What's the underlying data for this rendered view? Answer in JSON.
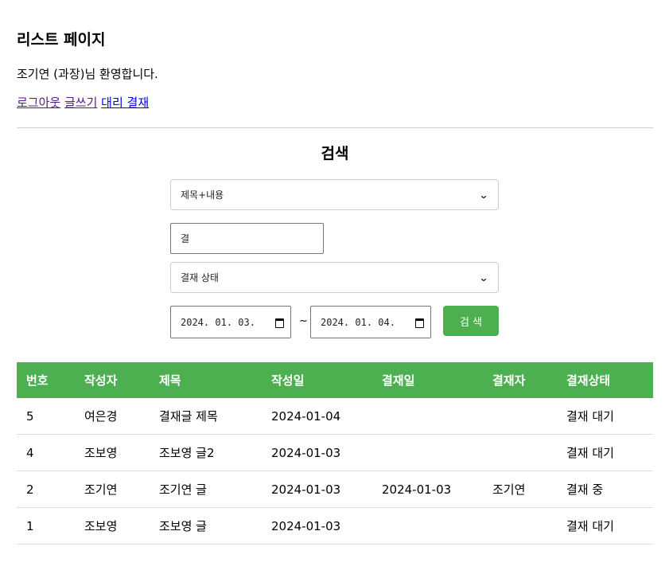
{
  "header": {
    "title": "리스트 페이지",
    "welcome": "조기연 (과장)님 환영합니다.",
    "links": {
      "logout": "로그아웃",
      "write": "글쓰기",
      "proxy_approval": "대리 결재"
    }
  },
  "search": {
    "title": "검색",
    "type_select": "제목+내용",
    "keyword": "결",
    "status_select": "결재 상태",
    "date_from": "2024. 01. 03.",
    "tilde": "~",
    "date_to": "2024. 01. 04.",
    "button": "검 색"
  },
  "table": {
    "headers": [
      "번호",
      "작성자",
      "제목",
      "작성일",
      "결재일",
      "결재자",
      "결재상태"
    ],
    "rows": [
      [
        "5",
        "여은경",
        "결재글 제목",
        "2024-01-04",
        "",
        "",
        "결재 대기"
      ],
      [
        "4",
        "조보영",
        "조보영 글2",
        "2024-01-03",
        "",
        "",
        "결재 대기"
      ],
      [
        "2",
        "조기연",
        "조기연 글",
        "2024-01-03",
        "2024-01-03",
        "조기연",
        "결재 중"
      ],
      [
        "1",
        "조보영",
        "조보영 글",
        "2024-01-03",
        "",
        "",
        "결재 대기"
      ]
    ]
  },
  "colors": {
    "accent": "#4caf50",
    "link_visited": "#551a8b",
    "link_unvisited": "#0000ee"
  }
}
